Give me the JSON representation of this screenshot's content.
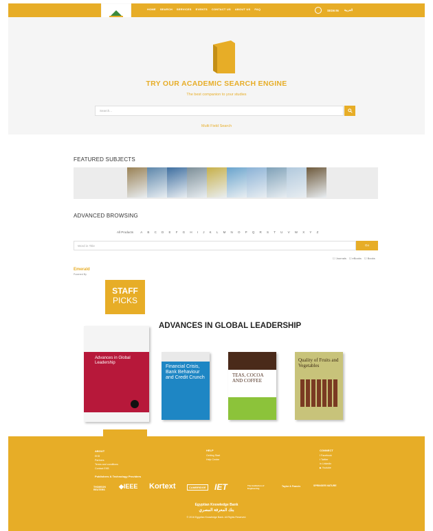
{
  "header": {
    "logo_text_line1": "Egyptian Knowledge Bank",
    "logo_text_line2": "بنك المعرفة المصري",
    "nav": [
      "HOME",
      "SEARCH",
      "SERVICES",
      "EVENTS",
      "CONTACT US",
      "ABOUT US",
      "FAQ"
    ],
    "account_label": "SIGN IN",
    "language_label": "العربية"
  },
  "hero": {
    "title": "TRY OUR ACADEMIC SEARCH ENGINE",
    "subtitle": "The best companion to your studies",
    "search_placeholder": "Search...",
    "multi_field_link": "Multi Field Search"
  },
  "featured": {
    "title": "FEATURED SUBJECTS",
    "thumb_colors": [
      "#9a8256",
      "#5e87ab",
      "#3f6fa0",
      "#7d8f98",
      "#c7b04a",
      "#6aa4cd",
      "#8bb2d6",
      "#7fa1b8",
      "#b1c9dd",
      "#6e5a3c"
    ]
  },
  "browse": {
    "title": "ADVANCED BROWSING",
    "all_products": "All Products",
    "letters": [
      "A",
      "B",
      "C",
      "D",
      "E",
      "F",
      "G",
      "H",
      "I",
      "J",
      "K",
      "L",
      "M",
      "N",
      "O",
      "P",
      "Q",
      "R",
      "S",
      "T",
      "U",
      "V",
      "W",
      "X",
      "Y",
      "Z"
    ],
    "word_placeholder": "Word in Title",
    "go_label": "Go",
    "filters": [
      "Journals",
      "eBooks",
      "Books"
    ],
    "powered_logo": "Emerald",
    "powered_by": "Powered By"
  },
  "staff_picks": {
    "line1": "STAFF",
    "line2": "PICKS",
    "heading": "ADVANCES IN GLOBAL LEADERSHIP",
    "books": [
      {
        "title": "Advances in Global Leadership",
        "color": "#b7183a"
      },
      {
        "title": "Financial Crisis, Bank Behaviour and Credit Crunch",
        "color": "#1e86c4"
      },
      {
        "title": "TEAS, COCOA AND COFFEE",
        "color": "#ffffff"
      },
      {
        "title": "Quality of Fruits and Vegetables",
        "color": "#c8c37a"
      }
    ]
  },
  "footer": {
    "about_title": "ABOUT",
    "about_links": [
      "EKB",
      "Partners",
      "Terms and conditions",
      "Contact EKB"
    ],
    "help_title": "HELP",
    "help_links": [
      "Getting Start",
      "Help Centre"
    ],
    "connect_title": "CONNECT",
    "connect_links": [
      "Facebook",
      "Twitter",
      "Linkedin",
      "Youtube"
    ],
    "partners_title": "Publishers & Technology Providers",
    "partners": [
      "THOMSON REUTERS",
      "IEEE",
      "Kortext",
      "CAMBRIDGE",
      "IET",
      "The Institution of Engineering",
      "SPRINGER NATURE",
      "Taylor & Francis"
    ],
    "brand_en": "Egyptian Knowledge Bank",
    "brand_ar": "بنك المعرفة المصري",
    "copyright": "© 2016 Egyptian Knowledge Bank. All Rights Reserved."
  }
}
